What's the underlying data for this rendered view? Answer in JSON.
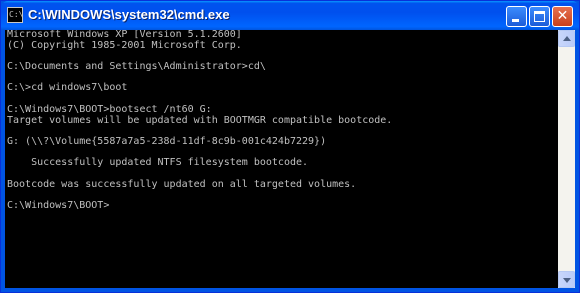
{
  "window": {
    "title": "C:\\WINDOWS\\system32\\cmd.exe",
    "app_icon": "command-prompt-icon",
    "app_icon_glyph": "C:\\",
    "buttons": {
      "minimize_icon": "minimize-icon",
      "maximize_icon": "maximize-icon",
      "close_icon": "close-icon",
      "close_glyph": "✕"
    }
  },
  "console": {
    "lines": [
      "Microsoft Windows XP [Version 5.1.2600]",
      "(C) Copyright 1985-2001 Microsoft Corp.",
      "",
      "C:\\Documents and Settings\\Administrator>cd\\",
      "",
      "C:\\>cd windows7\\boot",
      "",
      "C:\\Windows7\\BOOT>bootsect /nt60 G:",
      "Target volumes will be updated with BOOTMGR compatible bootcode.",
      "",
      "G: (\\\\?\\Volume{5587a7a5-238d-11df-8c9b-001c424b7229})",
      "",
      "    Successfully updated NTFS filesystem bootcode.",
      "",
      "Bootcode was successfully updated on all targeted volumes.",
      "",
      "C:\\Windows7\\BOOT>"
    ]
  },
  "scrollbar": {
    "up_icon": "scroll-up-arrow-icon",
    "down_icon": "scroll-down-arrow-icon"
  },
  "colors": {
    "titlebar": "#0054e3",
    "console_bg": "#000000",
    "console_text": "#c0c0c0",
    "close_button": "#d6542c"
  }
}
